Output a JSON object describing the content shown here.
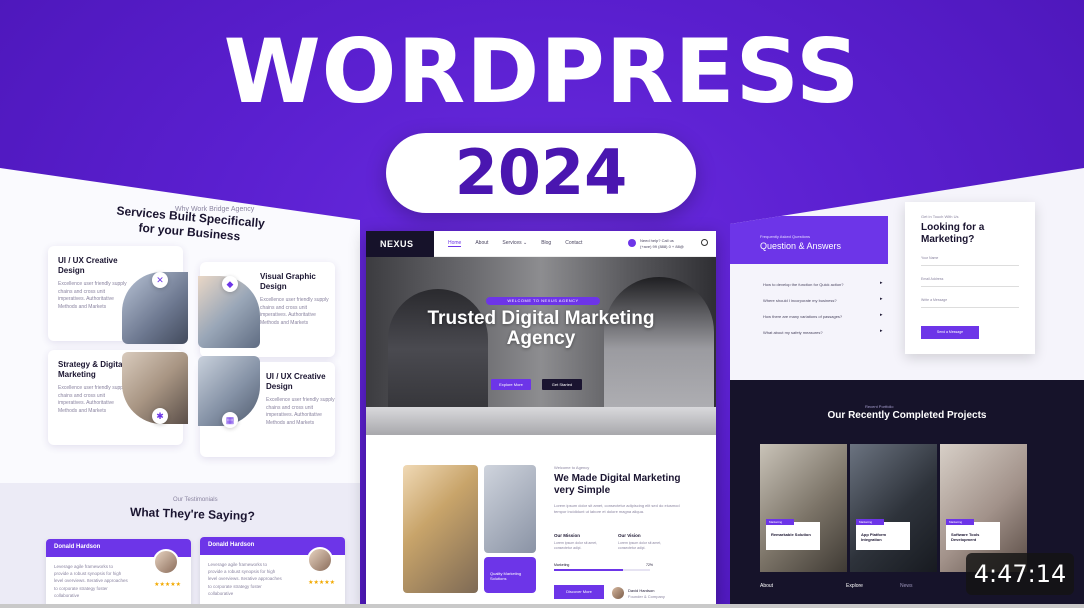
{
  "thumbnail": {
    "title": "WORDPRESS",
    "year": "2024",
    "duration": "4:47:14"
  },
  "left_mockup": {
    "tag": "Why Work Bridge Agency",
    "heading": "Services Built Specifically for your Business",
    "services": [
      {
        "title": "UI / UX Creative Design",
        "desc": "Excellence user friendly supply chains and cross unit imperatives. Authoritative Methods and Markets"
      },
      {
        "title": "Visual Graphic Design",
        "desc": "Excellence user friendly supply chains and cross unit imperatives. Authoritative Methods and Markets"
      },
      {
        "title": "Strategy & Digital Marketing",
        "desc": "Excellence user friendly supply chains and cross unit imperatives. Authoritative Methods and Markets"
      },
      {
        "title": "UI / UX Creative Design",
        "desc": "Excellence user friendly supply chains and cross unit imperatives. Authoritative Methods and Markets"
      }
    ],
    "testimonials_tag": "Our Testimonials",
    "testimonials_heading": "What They're Saying?",
    "testimonials": [
      {
        "name": "Donald Hardson",
        "text": "Leverage agile frameworks to provide a robust synopsis for high level overviews. Iterative approaches to corporate strategy foster collaborative",
        "stars": "★★★★★"
      },
      {
        "name": "Donald Hardson",
        "text": "Leverage agile frameworks to provide a robust synopsis for high level overviews. Iterative approaches to corporate strategy foster collaborative",
        "stars": "★★★★★"
      }
    ]
  },
  "center_mockup": {
    "logo": "NEXUS",
    "menu": [
      "Home",
      "About",
      "Services ⌄",
      "Blog",
      "Contact"
    ],
    "phone_label": "Need help? Call us",
    "phone_number": "(+ave) 99 (888) 0 + 88@",
    "welcome": "WELCOME TO NEXUS AGENCY",
    "hero_title": "Trusted Digital Marketing Agency",
    "btn_primary": "Explore More",
    "btn_secondary": "Get Started",
    "about_tag": "Welcome to Agency",
    "about_heading": "We Made Digital Marketing very Simple",
    "about_desc": "Lorem ipsum dolor sit amet, consectetur adipiscing elit sed do eiusmod tempor incididunt ut labore et dolore magna aliqua.",
    "feature1": "Our Mission",
    "feature1_desc": "Lorem ipsum dolor sit amet, consectetur adipi.",
    "feature2": "Our Vision",
    "feature2_desc": "Lorem ipsum dolor sit amet, consectetur adipi.",
    "bar_label": "Marketing",
    "bar_value": "72%",
    "bar_fraction": 0.72,
    "badge_text": "Quality Marketing Solutions",
    "btn_discover": "Discover More",
    "author_name": "David Hardson",
    "author_role": "Founder & Company"
  },
  "right_mockup": {
    "qa_tag": "Frequently Asked Questions",
    "qa_heading": "Question & Answers",
    "questions": [
      "How to develop the function for Quick action?",
      "Where should I incorporate my business?",
      "How there are many variations of passages?",
      "What about my safety measures?"
    ],
    "form_tag": "Get in Touch With Us",
    "form_heading": "Looking for a Marketing?",
    "form_fields": [
      "Your Name",
      "Email Address",
      "Write a Message"
    ],
    "form_button": "Send a Message",
    "projects_tag": "Recent Portfolio",
    "projects_heading": "Our Recently Completed Projects",
    "projects": [
      {
        "tag": "Marketing",
        "title": "Remarkable Solution"
      },
      {
        "tag": "Marketing",
        "title": "App Platform Integration"
      },
      {
        "tag": "Marketing",
        "title": "Software Tools Development"
      }
    ],
    "footer_items": [
      "About",
      "Explore",
      "News"
    ]
  }
}
